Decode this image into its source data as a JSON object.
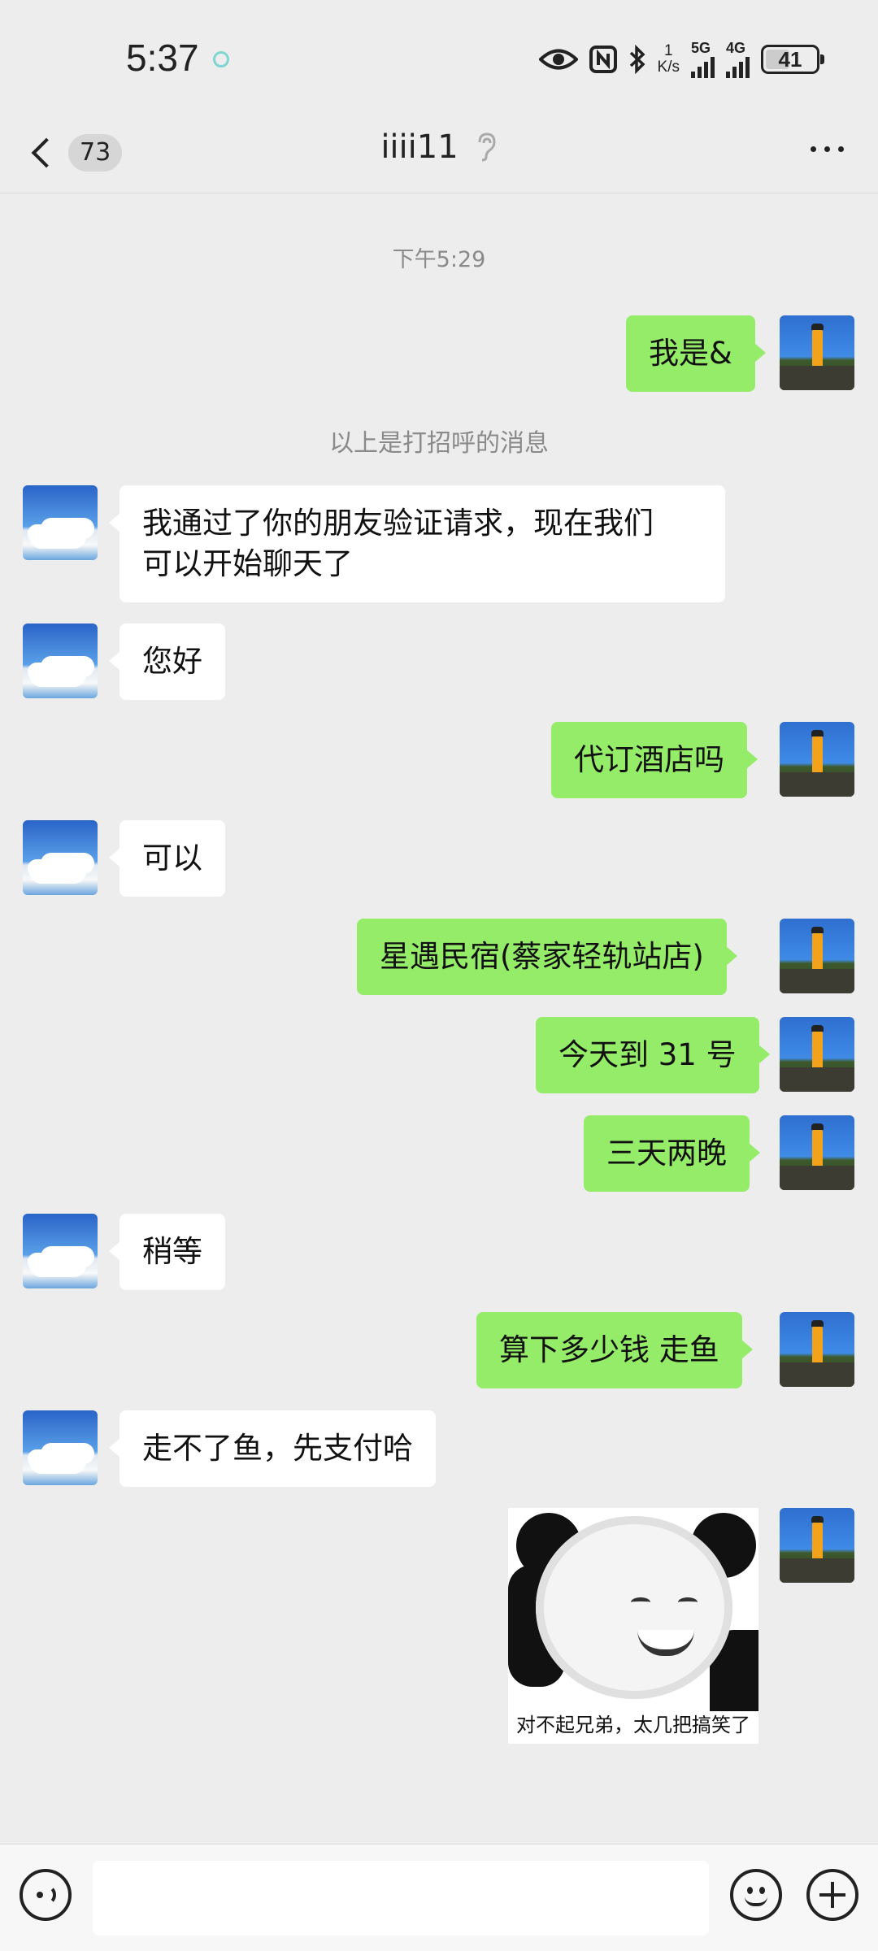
{
  "status_bar": {
    "time": "5:37",
    "speed_top": "1",
    "speed_unit": "K/s",
    "sig1": "5G",
    "sig2": "4G",
    "battery": "41"
  },
  "header": {
    "unread_count": "73",
    "contact_name": "iiii11",
    "ear_icon": "ear-icon"
  },
  "chat": {
    "timestamp": "下午5:29",
    "greeting_note": "以上是打招呼的消息",
    "messages": [
      {
        "from": "me",
        "text": "我是&"
      },
      {
        "from": "them",
        "text_line1": "我通过了你的朋友验证请求，现在我们",
        "text_line2": "可以开始聊天了"
      },
      {
        "from": "them",
        "text": "您好"
      },
      {
        "from": "me",
        "text": "代订酒店吗"
      },
      {
        "from": "them",
        "text": "可以"
      },
      {
        "from": "me",
        "text": "星遇民宿(蔡家轻轨站店)"
      },
      {
        "from": "me",
        "text": "今天到 31 号"
      },
      {
        "from": "me",
        "text": "三天两晚"
      },
      {
        "from": "them",
        "text": "稍等"
      },
      {
        "from": "me",
        "text": "算下多少钱 走鱼"
      },
      {
        "from": "them",
        "text": "走不了鱼，先支付哈"
      },
      {
        "from": "me",
        "sticker_caption": "对不起兄弟，太几把搞笑了"
      }
    ]
  },
  "input_bar": {
    "value": "",
    "icons": [
      "voice-icon",
      "emoji-icon",
      "plus-icon"
    ]
  },
  "colors": {
    "background": "#ededed",
    "my_bubble": "#95ec69",
    "their_bubble": "#ffffff"
  }
}
